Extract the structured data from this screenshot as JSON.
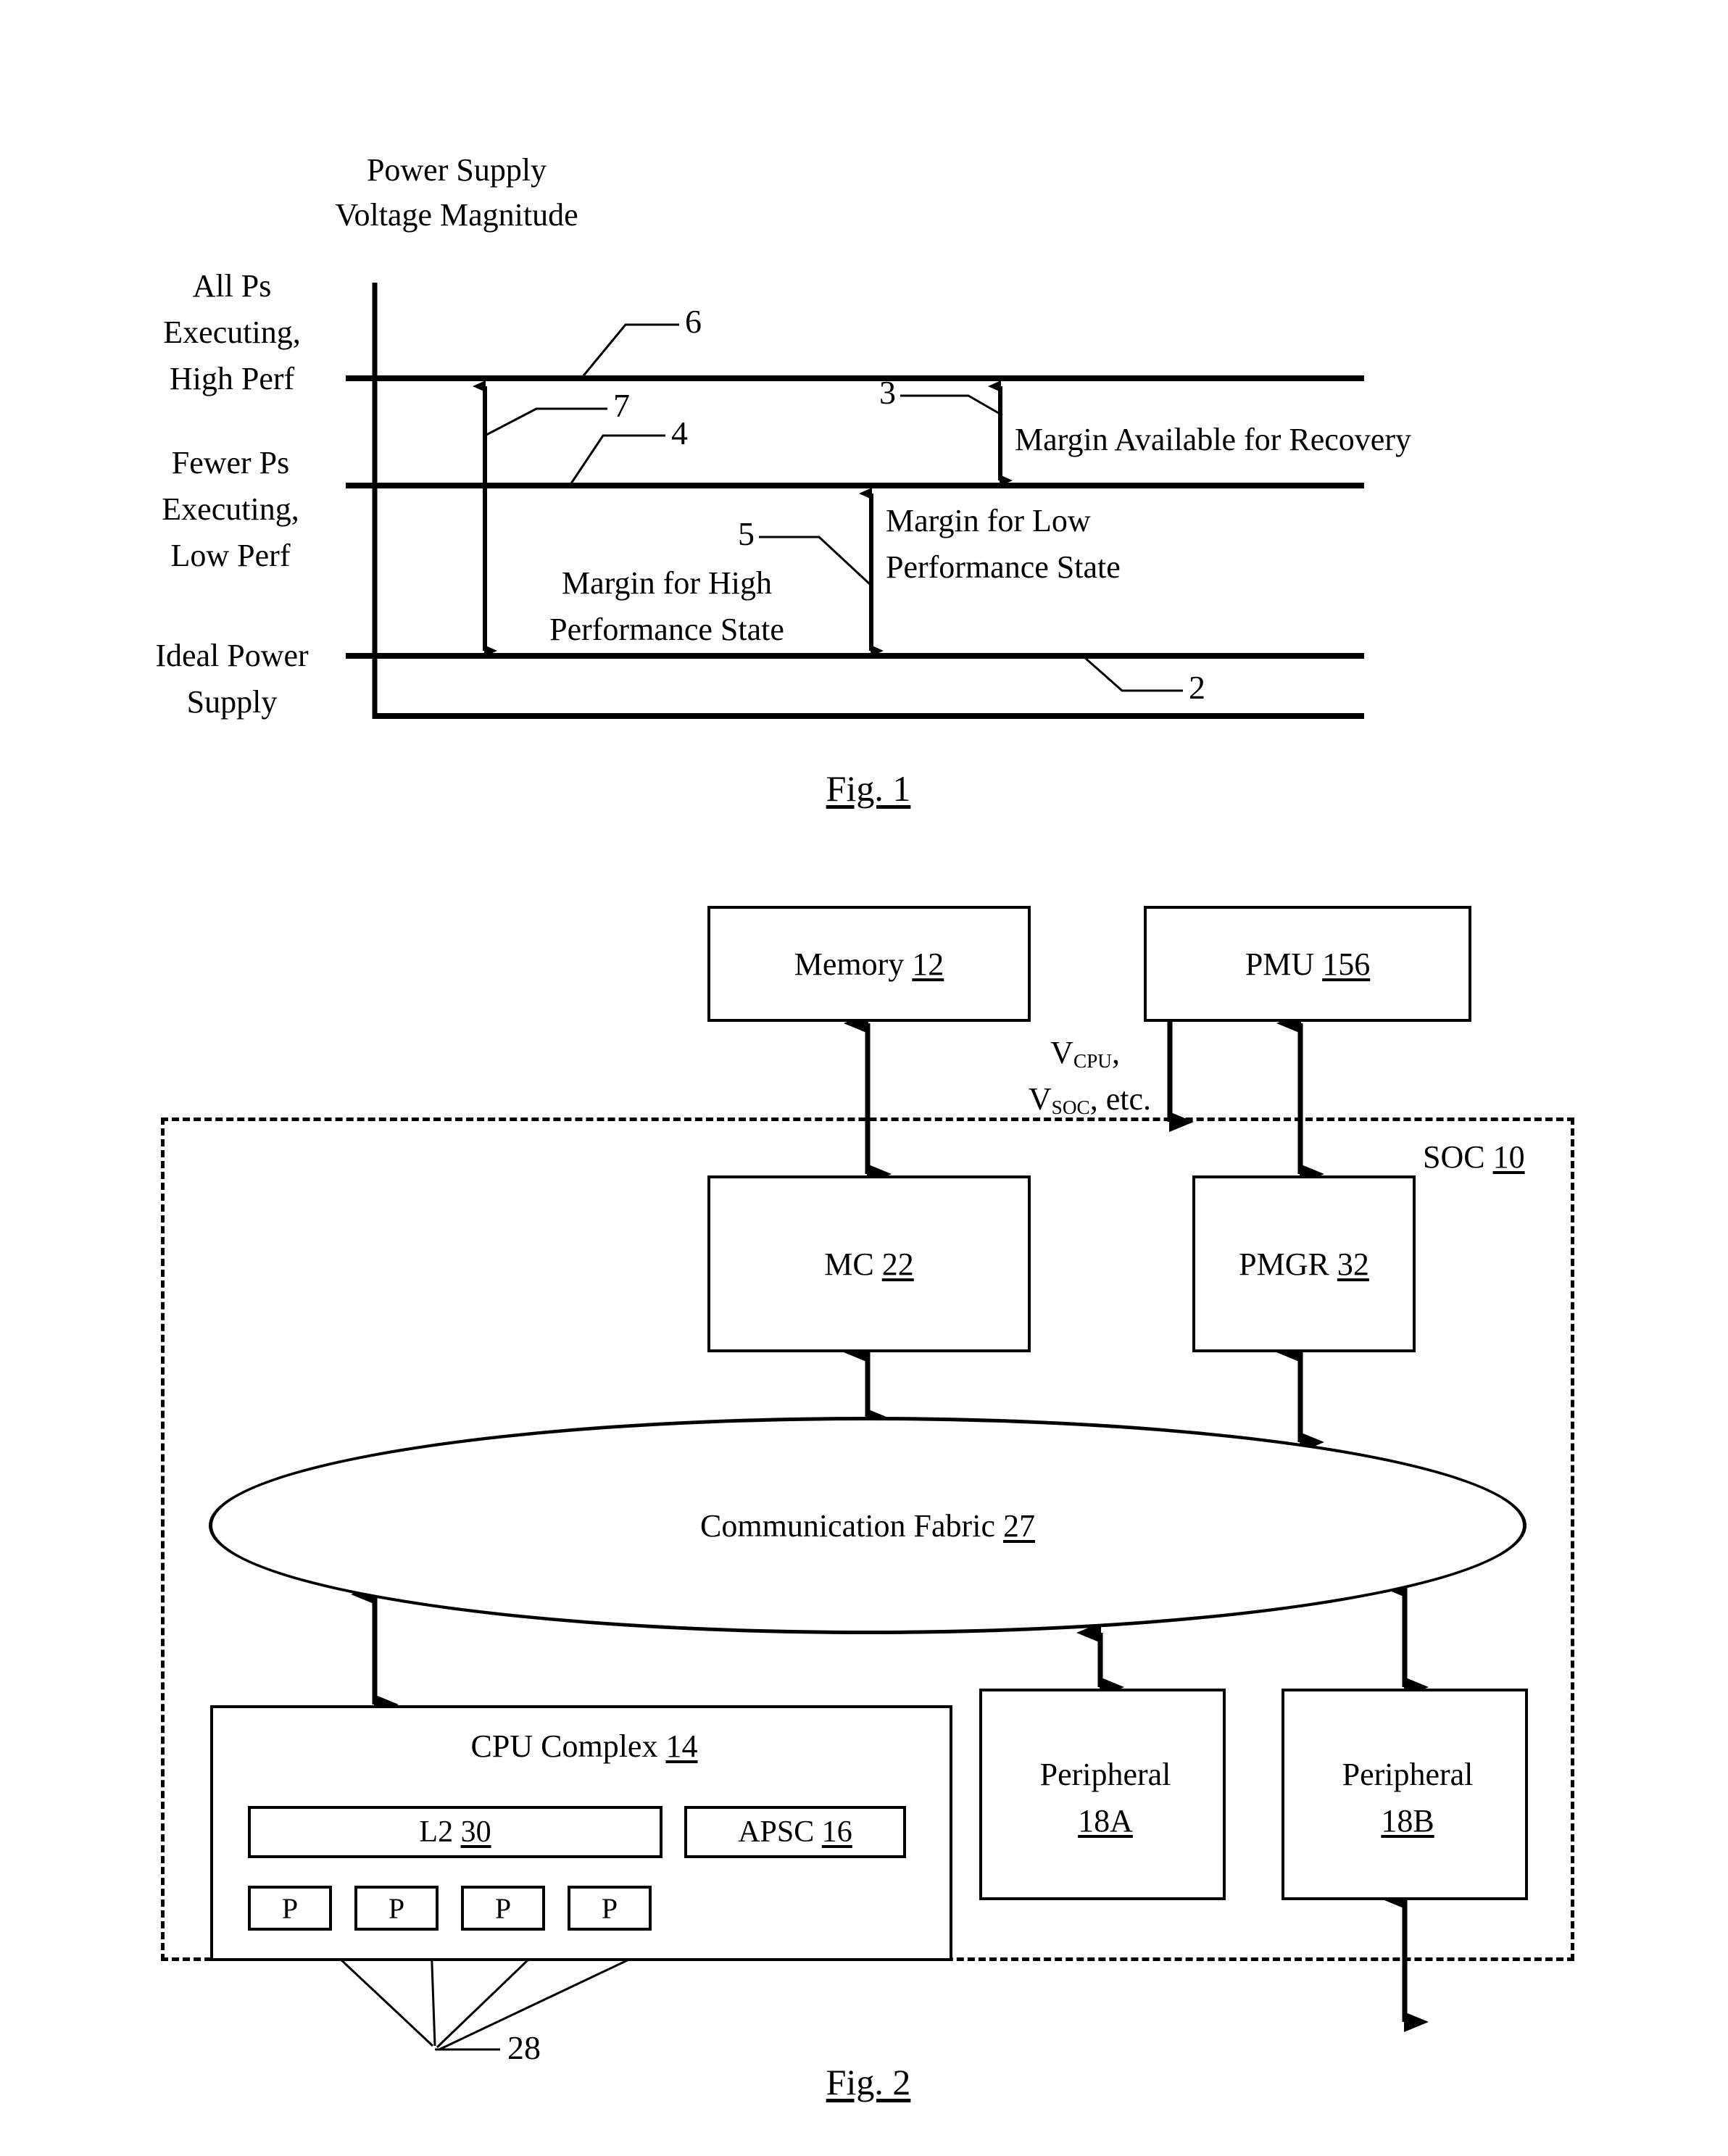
{
  "figure1": {
    "caption": "Fig. 1",
    "axis_title_line1": "Power Supply",
    "axis_title_line2": "Voltage Magnitude",
    "y_labels": [
      {
        "lines": [
          "All Ps",
          "Executing,",
          "High Perf"
        ]
      },
      {
        "lines": [
          "Fewer Ps",
          "Executing,",
          "Low Perf"
        ]
      },
      {
        "lines": [
          "Ideal Power",
          "Supply"
        ]
      }
    ],
    "ref_numbers": [
      "6",
      "7",
      "4",
      "3",
      "5",
      "2"
    ],
    "annotations": [
      {
        "id": "margin-recovery",
        "lines": [
          "Margin Available for Recovery"
        ]
      },
      {
        "id": "margin-low",
        "lines": [
          "Margin for Low",
          "Performance State"
        ]
      },
      {
        "id": "margin-high",
        "lines": [
          "Margin for High",
          "Performance State"
        ]
      }
    ]
  },
  "figure2": {
    "caption": "Fig. 2",
    "memory": {
      "label": "Memory ",
      "ref": "12"
    },
    "pmu": {
      "label": "PMU ",
      "ref": "156"
    },
    "voltage_rail_line1_pre": "V",
    "voltage_rail_line1_sub": "CPU",
    "voltage_rail_line1_post": ",",
    "voltage_rail_line2_pre": "V",
    "voltage_rail_line2_sub": "SOC",
    "voltage_rail_line2_post": ", etc.",
    "soc": {
      "label": "SOC ",
      "ref": "10"
    },
    "mc": {
      "label": "MC ",
      "ref": "22"
    },
    "pmgr": {
      "label": "PMGR ",
      "ref": "32"
    },
    "fabric": {
      "label": "Communication Fabric ",
      "ref": "27"
    },
    "cpu_complex": {
      "label": "CPU Complex ",
      "ref": "14"
    },
    "l2": {
      "label": "L2 ",
      "ref": "30"
    },
    "apsc": {
      "label": "APSC ",
      "ref": "16"
    },
    "processors": [
      {
        "label": "P"
      },
      {
        "label": "P"
      },
      {
        "label": "P"
      },
      {
        "label": "P"
      }
    ],
    "processor_ref": "28",
    "peripherals": [
      {
        "label": "Peripheral",
        "ref": "18A"
      },
      {
        "label": "Peripheral",
        "ref": "18B"
      }
    ]
  }
}
